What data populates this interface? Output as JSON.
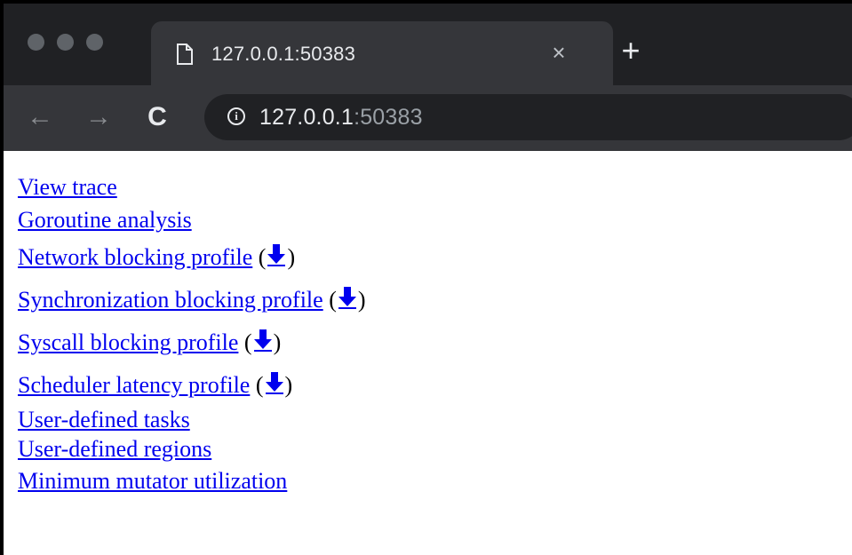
{
  "browser": {
    "tab": {
      "title": "127.0.0.1:50383",
      "close_label": "×",
      "icon": "page-icon"
    },
    "new_tab_label": "+",
    "nav": {
      "back_label": "←",
      "forward_label": "→",
      "reload_label": "C"
    },
    "omnibox": {
      "host": "127.0.0.1",
      "port": ":50383",
      "info_icon_label": "i"
    }
  },
  "links": [
    {
      "label": "View trace"
    },
    {
      "label": "Goroutine analysis"
    },
    {
      "label": "Network blocking profile",
      "download": true
    },
    {
      "label": "Synchronization blocking profile",
      "download": true
    },
    {
      "label": "Syscall blocking profile",
      "download": true
    },
    {
      "label": "Scheduler latency profile",
      "download": true
    },
    {
      "label": "User-defined tasks"
    },
    {
      "label": "User-defined regions"
    },
    {
      "label": "Minimum mutator utilization"
    }
  ],
  "download_parts": {
    "open": " (",
    "close": ")"
  },
  "colors": {
    "link": "#0000ee",
    "tab_bar": "#202124",
    "toolbar": "#35363a"
  }
}
